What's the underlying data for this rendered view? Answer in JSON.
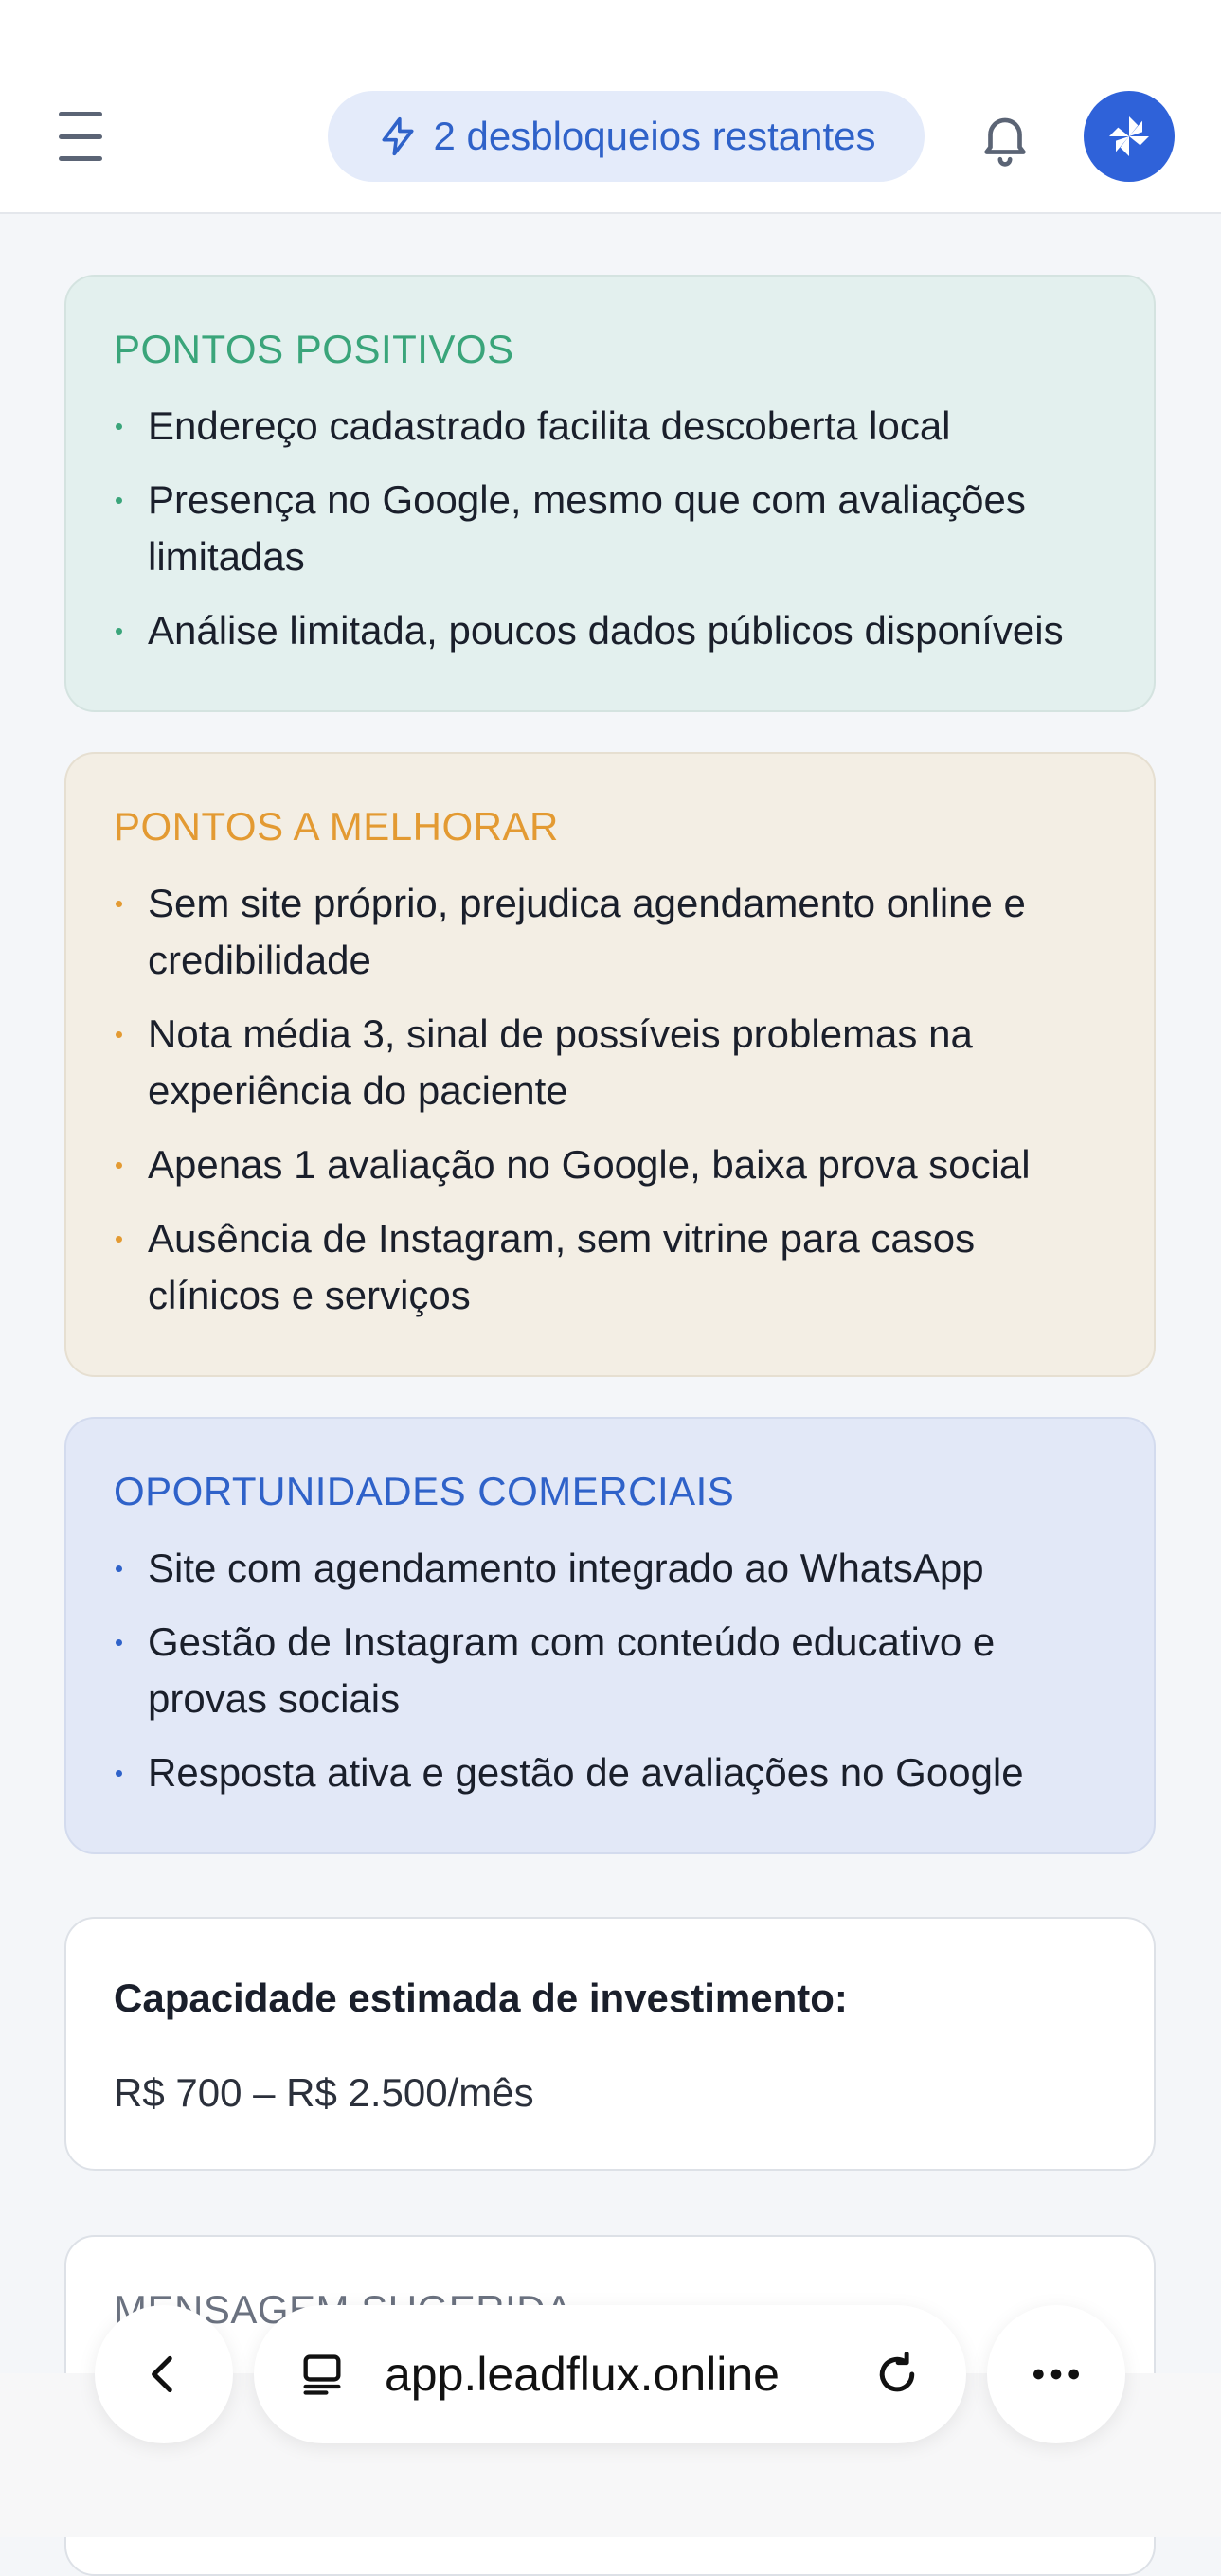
{
  "header": {
    "unlocks_label": "2 desbloqueios restantes"
  },
  "positives": {
    "title": "PONTOS POSITIVOS",
    "items": [
      "Endereço cadastrado facilita descoberta local",
      "Presença no Google, mesmo que com avaliações limitadas",
      "Análise limitada, poucos dados públicos disponíveis"
    ]
  },
  "improvements": {
    "title": "PONTOS A MELHORAR",
    "items": [
      "Sem site próprio, prejudica agendamento online e credibilidade",
      "Nota média 3, sinal de possíveis problemas na experiência do paciente",
      "Apenas 1 avaliação no Google, baixa prova social",
      "Ausência de Instagram, sem vitrine para casos clínicos e serviços"
    ]
  },
  "opportunities": {
    "title": "OPORTUNIDADES COMERCIAIS",
    "items": [
      "Site com agendamento integrado ao WhatsApp",
      "Gestão de Instagram com conteúdo educativo e provas sociais",
      "Resposta ativa e gestão de avaliações no Google"
    ]
  },
  "capacity": {
    "label": "Capacidade estimada de investimento:",
    "value": "R$ 700 – R$ 2.500/mês"
  },
  "message": {
    "title": "MENSAGEM SUGERIDA"
  },
  "browser": {
    "url": "app.leadflux.online"
  },
  "colors": {
    "accent": "#2f62d9",
    "positive": "#3aa57a",
    "warning": "#e39a32"
  }
}
